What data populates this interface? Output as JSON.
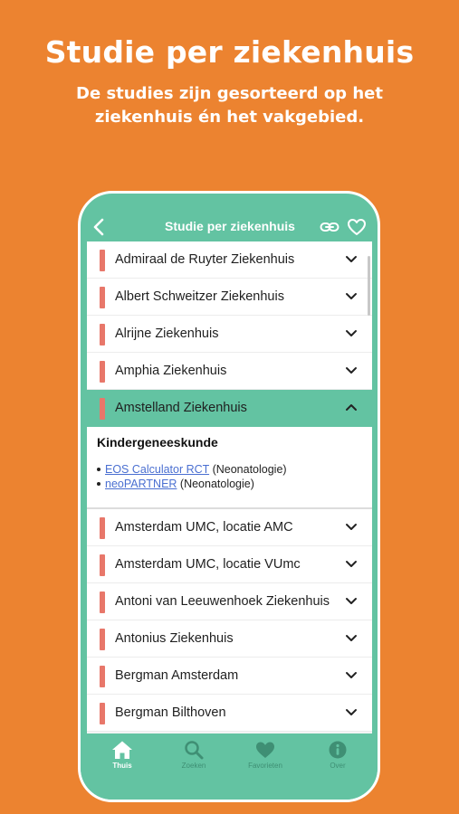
{
  "hero": {
    "title": "Studie per ziekenhuis",
    "subtitle_line1": "De studies zijn gesorteerd op het",
    "subtitle_line2": "ziekenhuis én het vakgebied."
  },
  "navbar": {
    "title": "Studie per ziekenhuis",
    "back_icon": "chevron-left-icon",
    "link_icon": "link-icon",
    "favorite_icon": "heart-outline-icon"
  },
  "hospitals": [
    {
      "label": "Admiraal de Ruyter Ziekenhuis",
      "expanded": false
    },
    {
      "label": "Albert Schweitzer Ziekenhuis",
      "expanded": false
    },
    {
      "label": "Alrijne Ziekenhuis",
      "expanded": false
    },
    {
      "label": "Amphia Ziekenhuis",
      "expanded": false
    },
    {
      "label": "Amstelland Ziekenhuis",
      "expanded": true
    },
    {
      "label": "Amsterdam UMC, locatie AMC",
      "expanded": false
    },
    {
      "label": "Amsterdam UMC, locatie VUmc",
      "expanded": false
    },
    {
      "label": "Antoni van Leeuwenhoek Ziekenhuis",
      "expanded": false
    },
    {
      "label": "Antonius Ziekenhuis",
      "expanded": false
    },
    {
      "label": "Bergman Amsterdam",
      "expanded": false
    },
    {
      "label": "Bergman Bilthoven",
      "expanded": false
    }
  ],
  "expanded_section": {
    "heading": "Kindergeneeskunde",
    "studies": [
      {
        "link": "EOS Calculator RCT",
        "suffix": " (Neonatologie)"
      },
      {
        "link": "neoPARTNER",
        "suffix": " (Neonatologie)"
      }
    ]
  },
  "tabbar": {
    "tabs": [
      {
        "label": "Thuis",
        "icon": "home-icon",
        "active": true
      },
      {
        "label": "Zoeken",
        "icon": "search-icon",
        "active": false
      },
      {
        "label": "Favorieten",
        "icon": "heart-icon",
        "active": false
      },
      {
        "label": "Over",
        "icon": "info-icon",
        "active": false
      }
    ]
  },
  "colors": {
    "background": "#ec8330",
    "accent": "#63c3a2",
    "marker": "#e8776a",
    "link": "#4a6fd1"
  }
}
